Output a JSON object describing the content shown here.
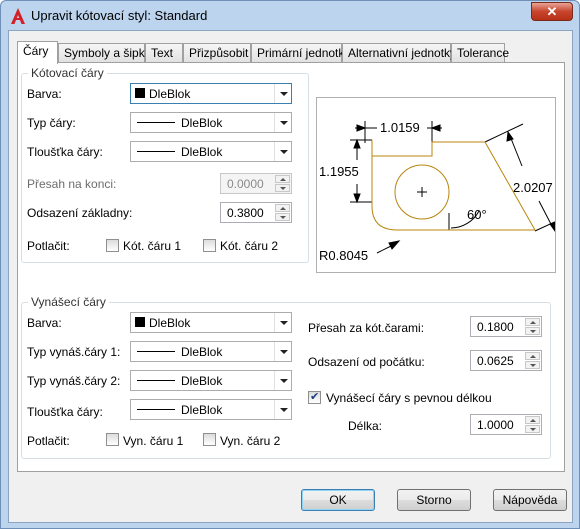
{
  "window": {
    "title": "Upravit kótovací styl: Standard",
    "close": "✕"
  },
  "tabs": [
    "Čáry",
    "Symboly a šipky",
    "Text",
    "Přizpůsobit",
    "Primární jednotky",
    "Alternativní jednotky",
    "Tolerance"
  ],
  "dim_lines": {
    "group_title": "Kótovací čáry",
    "color_label": "Barva:",
    "color_value": "DleBlok",
    "linetype_label": "Typ čáry:",
    "linetype_value": "DleBlok",
    "lineweight_label": "Tloušťka čáry:",
    "lineweight_value": "DleBlok",
    "extend_label": "Přesah na konci:",
    "extend_value": "0.0000",
    "baseline_label": "Odsazení základny:",
    "baseline_value": "0.3800",
    "suppress_label": "Potlačit:",
    "suppress1": "Kót. čáru 1",
    "suppress2": "Kót. čáru 2"
  },
  "ext_lines": {
    "group_title": "Vynášecí čáry",
    "color_label": "Barva:",
    "color_value": "DleBlok",
    "lt1_label": "Typ vynáš.čáry 1:",
    "lt1_value": "DleBlok",
    "lt2_label": "Typ vynáš.čáry 2:",
    "lt2_value": "DleBlok",
    "lineweight_label": "Tloušťka čáry:",
    "lineweight_value": "DleBlok",
    "suppress_label": "Potlačit:",
    "suppress1": "Vyn. čáru 1",
    "suppress2": "Vyn. čáru 2",
    "extend_label": "Přesah za kót.čarami:",
    "extend_value": "0.1800",
    "offset_label": "Odsazení od počátku:",
    "offset_value": "0.0625",
    "fixed_label": "Vynášecí čáry s pevnou délkou",
    "length_label": "Délka:",
    "length_value": "1.0000"
  },
  "preview": {
    "dim_top": "1.0159",
    "dim_left": "1.1955",
    "dim_right": "2.0207",
    "angle": "60°",
    "radius": "R0.8045"
  },
  "buttons": {
    "ok": "OK",
    "cancel": "Storno",
    "help": "Nápověda"
  }
}
